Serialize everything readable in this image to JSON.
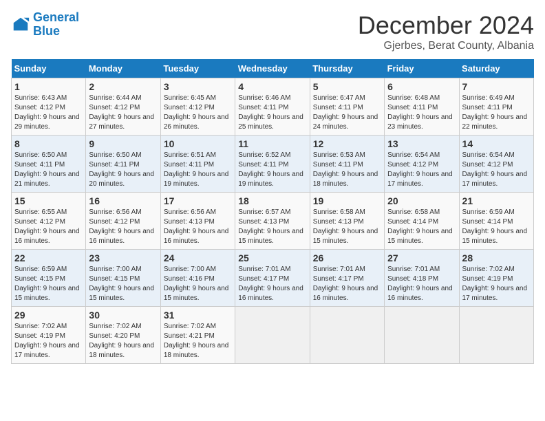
{
  "header": {
    "logo_line1": "General",
    "logo_line2": "Blue",
    "month_title": "December 2024",
    "location": "Gjerbes, Berat County, Albania"
  },
  "weekdays": [
    "Sunday",
    "Monday",
    "Tuesday",
    "Wednesday",
    "Thursday",
    "Friday",
    "Saturday"
  ],
  "weeks": [
    [
      {
        "day": "1",
        "sunrise": "6:43 AM",
        "sunset": "4:12 PM",
        "daylight": "9 hours and 29 minutes."
      },
      {
        "day": "2",
        "sunrise": "6:44 AM",
        "sunset": "4:12 PM",
        "daylight": "9 hours and 27 minutes."
      },
      {
        "day": "3",
        "sunrise": "6:45 AM",
        "sunset": "4:12 PM",
        "daylight": "9 hours and 26 minutes."
      },
      {
        "day": "4",
        "sunrise": "6:46 AM",
        "sunset": "4:11 PM",
        "daylight": "9 hours and 25 minutes."
      },
      {
        "day": "5",
        "sunrise": "6:47 AM",
        "sunset": "4:11 PM",
        "daylight": "9 hours and 24 minutes."
      },
      {
        "day": "6",
        "sunrise": "6:48 AM",
        "sunset": "4:11 PM",
        "daylight": "9 hours and 23 minutes."
      },
      {
        "day": "7",
        "sunrise": "6:49 AM",
        "sunset": "4:11 PM",
        "daylight": "9 hours and 22 minutes."
      }
    ],
    [
      {
        "day": "8",
        "sunrise": "6:50 AM",
        "sunset": "4:11 PM",
        "daylight": "9 hours and 21 minutes."
      },
      {
        "day": "9",
        "sunrise": "6:50 AM",
        "sunset": "4:11 PM",
        "daylight": "9 hours and 20 minutes."
      },
      {
        "day": "10",
        "sunrise": "6:51 AM",
        "sunset": "4:11 PM",
        "daylight": "9 hours and 19 minutes."
      },
      {
        "day": "11",
        "sunrise": "6:52 AM",
        "sunset": "4:11 PM",
        "daylight": "9 hours and 19 minutes."
      },
      {
        "day": "12",
        "sunrise": "6:53 AM",
        "sunset": "4:11 PM",
        "daylight": "9 hours and 18 minutes."
      },
      {
        "day": "13",
        "sunrise": "6:54 AM",
        "sunset": "4:12 PM",
        "daylight": "9 hours and 17 minutes."
      },
      {
        "day": "14",
        "sunrise": "6:54 AM",
        "sunset": "4:12 PM",
        "daylight": "9 hours and 17 minutes."
      }
    ],
    [
      {
        "day": "15",
        "sunrise": "6:55 AM",
        "sunset": "4:12 PM",
        "daylight": "9 hours and 16 minutes."
      },
      {
        "day": "16",
        "sunrise": "6:56 AM",
        "sunset": "4:12 PM",
        "daylight": "9 hours and 16 minutes."
      },
      {
        "day": "17",
        "sunrise": "6:56 AM",
        "sunset": "4:13 PM",
        "daylight": "9 hours and 16 minutes."
      },
      {
        "day": "18",
        "sunrise": "6:57 AM",
        "sunset": "4:13 PM",
        "daylight": "9 hours and 15 minutes."
      },
      {
        "day": "19",
        "sunrise": "6:58 AM",
        "sunset": "4:13 PM",
        "daylight": "9 hours and 15 minutes."
      },
      {
        "day": "20",
        "sunrise": "6:58 AM",
        "sunset": "4:14 PM",
        "daylight": "9 hours and 15 minutes."
      },
      {
        "day": "21",
        "sunrise": "6:59 AM",
        "sunset": "4:14 PM",
        "daylight": "9 hours and 15 minutes."
      }
    ],
    [
      {
        "day": "22",
        "sunrise": "6:59 AM",
        "sunset": "4:15 PM",
        "daylight": "9 hours and 15 minutes."
      },
      {
        "day": "23",
        "sunrise": "7:00 AM",
        "sunset": "4:15 PM",
        "daylight": "9 hours and 15 minutes."
      },
      {
        "day": "24",
        "sunrise": "7:00 AM",
        "sunset": "4:16 PM",
        "daylight": "9 hours and 15 minutes."
      },
      {
        "day": "25",
        "sunrise": "7:01 AM",
        "sunset": "4:17 PM",
        "daylight": "9 hours and 16 minutes."
      },
      {
        "day": "26",
        "sunrise": "7:01 AM",
        "sunset": "4:17 PM",
        "daylight": "9 hours and 16 minutes."
      },
      {
        "day": "27",
        "sunrise": "7:01 AM",
        "sunset": "4:18 PM",
        "daylight": "9 hours and 16 minutes."
      },
      {
        "day": "28",
        "sunrise": "7:02 AM",
        "sunset": "4:19 PM",
        "daylight": "9 hours and 17 minutes."
      }
    ],
    [
      {
        "day": "29",
        "sunrise": "7:02 AM",
        "sunset": "4:19 PM",
        "daylight": "9 hours and 17 minutes."
      },
      {
        "day": "30",
        "sunrise": "7:02 AM",
        "sunset": "4:20 PM",
        "daylight": "9 hours and 18 minutes."
      },
      {
        "day": "31",
        "sunrise": "7:02 AM",
        "sunset": "4:21 PM",
        "daylight": "9 hours and 18 minutes."
      },
      null,
      null,
      null,
      null
    ]
  ]
}
